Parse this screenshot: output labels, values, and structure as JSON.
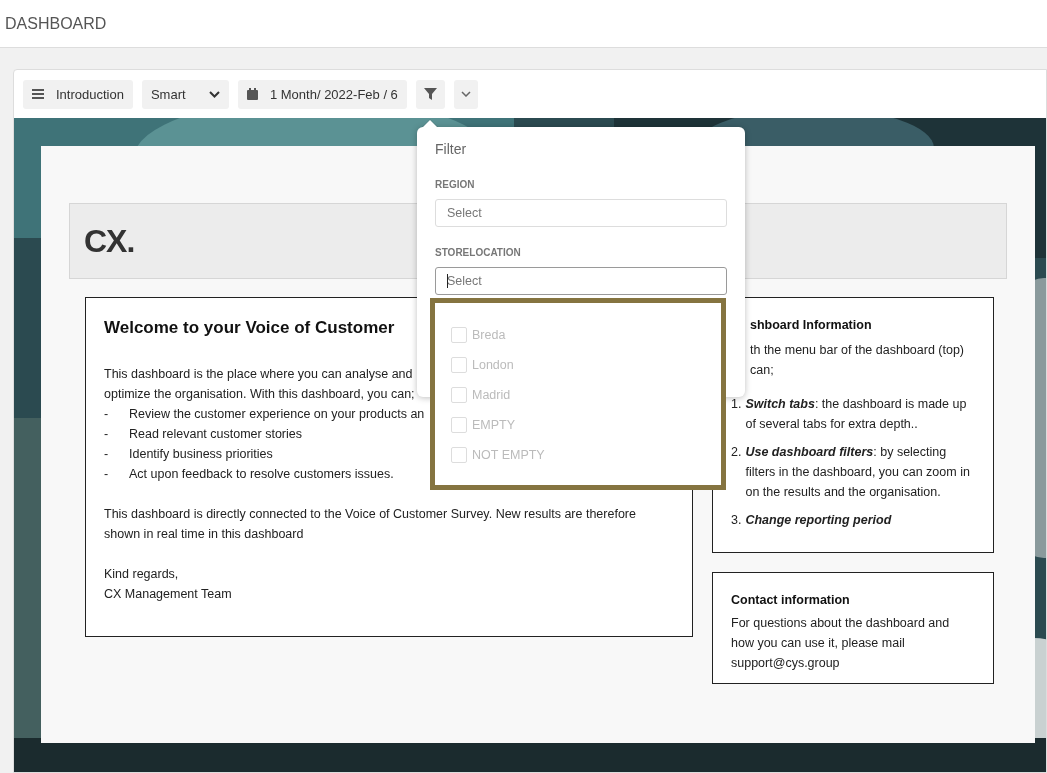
{
  "page_title": "DASHBOARD",
  "toolbar": {
    "menu_label": "Introduction",
    "view_select": "Smart",
    "period": "1 Month/ 2022-Feb / 6"
  },
  "banner": {
    "logo": "CX."
  },
  "welcome": {
    "title": "Welcome to your Voice of Customer",
    "intro": [
      "This dashboard is the place where you can analyse and",
      "optimize the organisation. With this dashboard, you can;"
    ],
    "bullets": [
      {
        "dash": "-",
        "text": "Review the customer experience on your products an"
      },
      {
        "dash": "-",
        "text": "Read relevant customer stories"
      },
      {
        "dash": "-",
        "text": "Identify business priorities"
      },
      {
        "dash": "-",
        "text": "Act upon feedback to resolve customers issues."
      }
    ],
    "paragraph": "This dashboard is directly connected to the Voice of Customer Survey. New results are therefore shown in real time in this dashboard",
    "closing": [
      "Kind regards,",
      "CX Management Team"
    ]
  },
  "info": {
    "title": "shboard Information",
    "intro": [
      "th the menu bar of the dashboard (top)",
      "can;"
    ],
    "steps": [
      {
        "num": "1.",
        "text": "**Switch tabs**: the dashboard is made up of several tabs for extra depth.."
      },
      {
        "num": "2.",
        "text": "**Use dashboard filters**: by selecting filters in the dashboard, you can zoom in on the results and the organisation."
      },
      {
        "num": "3.",
        "text": "**Change reporting period**"
      }
    ]
  },
  "contact": {
    "title": "Contact information",
    "text": "For questions about the dashboard and how you can use it, please mail support@cys.group"
  },
  "filter": {
    "title": "Filter",
    "fields": [
      {
        "label": "REGION",
        "placeholder": "Select",
        "focused": false
      },
      {
        "label": "STORELOCATION",
        "placeholder": "Select",
        "focused": true
      }
    ],
    "options": [
      {
        "label": "Breda",
        "checked": false
      },
      {
        "label": "London",
        "checked": false
      },
      {
        "label": "Madrid",
        "checked": false
      },
      {
        "label": "EMPTY",
        "checked": false
      },
      {
        "label": "NOT EMPTY",
        "checked": false
      }
    ]
  }
}
